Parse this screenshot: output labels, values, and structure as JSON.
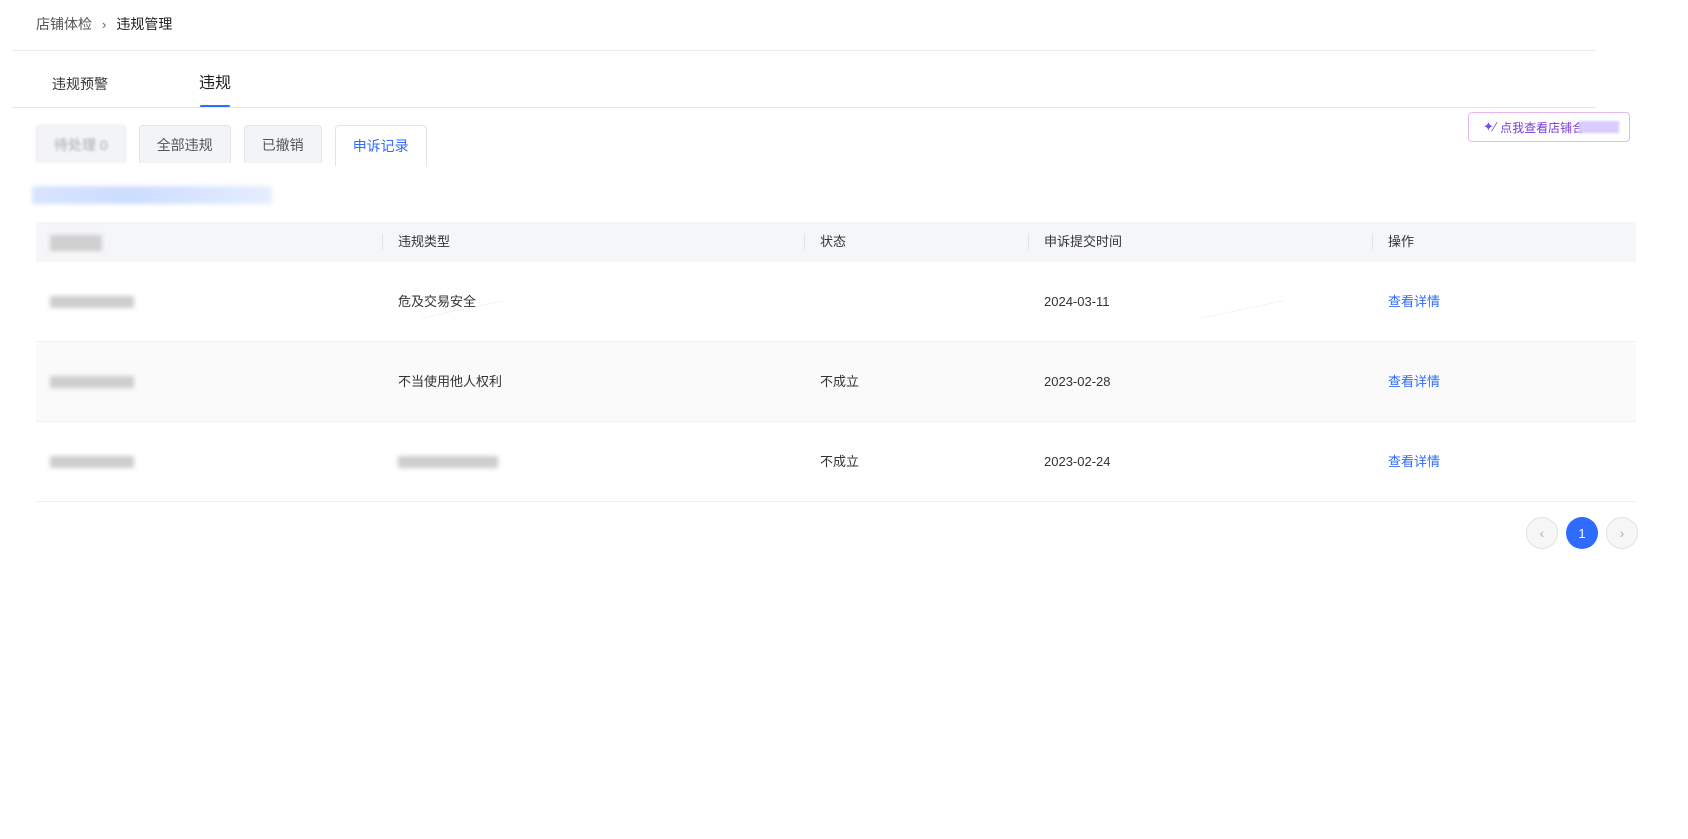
{
  "breadcrumb": {
    "root": "店铺体检",
    "current": "违规管理"
  },
  "main_tabs": [
    {
      "label": "违规预警"
    },
    {
      "label": "违规"
    }
  ],
  "sub_tabs": [
    {
      "label": "待处理 0"
    },
    {
      "label": "全部违规"
    },
    {
      "label": "已撤销"
    },
    {
      "label": "申诉记录"
    }
  ],
  "promo": {
    "label": "点我查看店铺合"
  },
  "table": {
    "headers": [
      "违规类型",
      "状态",
      "申诉提交时间",
      "操作"
    ],
    "rows": [
      {
        "type": "危及交易安全",
        "status": "",
        "date": "2024-03-11",
        "action": "查看详情"
      },
      {
        "type": "不当使用他人权利",
        "status": "不成立",
        "date": "2023-02-28",
        "action": "查看详情"
      },
      {
        "type": "",
        "status": "不成立",
        "date": "2023-02-24",
        "action": "查看详情"
      }
    ]
  },
  "pagination": {
    "current": "1",
    "prev_icon": "chevron-left-icon",
    "next_icon": "chevron-right-icon"
  },
  "colors": {
    "accent": "#2f6bff"
  }
}
